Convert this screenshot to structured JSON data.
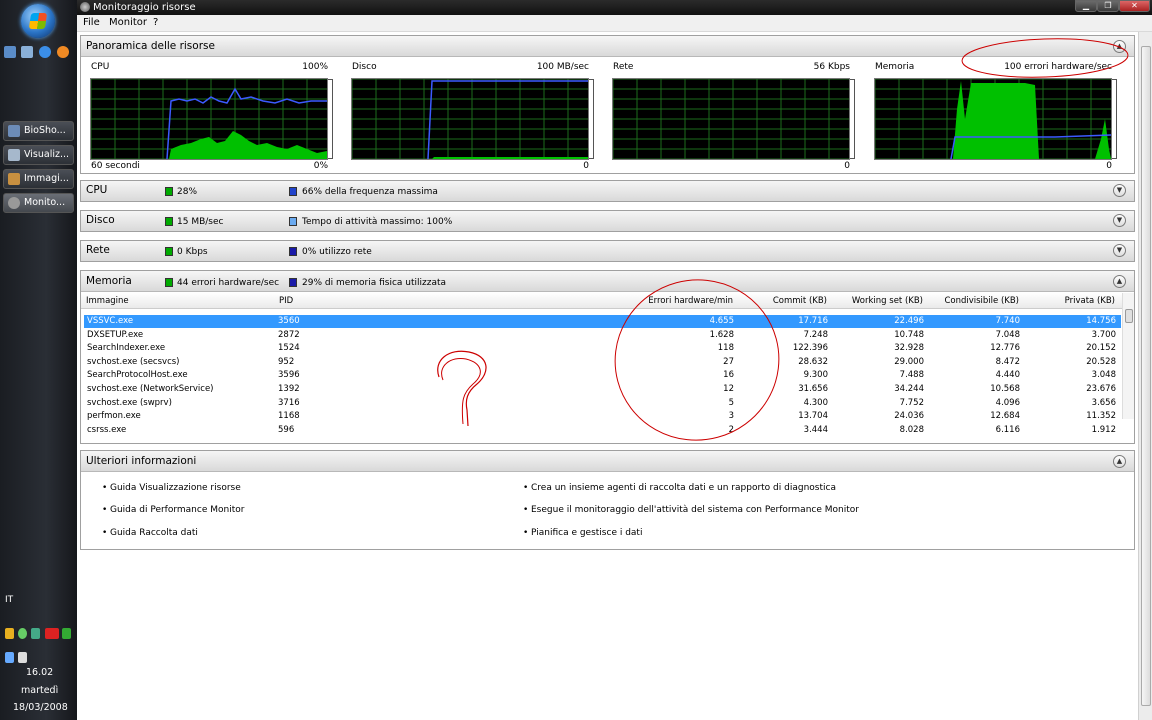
{
  "taskbar": {
    "buttons": [
      {
        "label": "BioSho..."
      },
      {
        "label": "Visualiz..."
      },
      {
        "label": "Immagi..."
      },
      {
        "label": "Monito..."
      }
    ],
    "lang": "IT",
    "time": "16.02",
    "day": "martedì",
    "date": "18/03/2008"
  },
  "window": {
    "title": "Monitoraggio risorse",
    "menu": [
      "File",
      "Monitor",
      "?"
    ]
  },
  "overview": {
    "title": "Panoramica delle risorse",
    "graphs": [
      {
        "name": "CPU",
        "max": "100%",
        "min": "0%",
        "footer": "60 secondi"
      },
      {
        "name": "Disco",
        "max": "100 MB/sec",
        "min": "0",
        "footer": ""
      },
      {
        "name": "Rete",
        "max": "56 Kbps",
        "min": "0",
        "footer": ""
      },
      {
        "name": "Memoria",
        "max": "100 errori hardware/sec",
        "min": "0",
        "footer": ""
      }
    ]
  },
  "sections": [
    {
      "title": "CPU",
      "stat1": "28%",
      "stat2": "66% della frequenza massima"
    },
    {
      "title": "Disco",
      "stat1": "15 MB/sec",
      "stat2": "Tempo di attività massimo: 100%"
    },
    {
      "title": "Rete",
      "stat1": "0 Kbps",
      "stat2": "0% utilizzo rete"
    },
    {
      "title": "Memoria",
      "stat1": "44 errori hardware/sec",
      "stat2": "29% di memoria fisica utilizzata"
    }
  ],
  "memory_table": {
    "columns": [
      "Immagine",
      "PID",
      "Errori hardware/min",
      "Commit (KB)",
      "Working set (KB)",
      "Condivisibile (KB)",
      "Privata (KB)"
    ],
    "rows": [
      [
        "VSSVC.exe",
        "3560",
        "4.655",
        "17.716",
        "22.496",
        "7.740",
        "14.756"
      ],
      [
        "DXSETUP.exe",
        "2872",
        "1.628",
        "7.248",
        "10.748",
        "7.048",
        "3.700"
      ],
      [
        "SearchIndexer.exe",
        "1524",
        "118",
        "122.396",
        "32.928",
        "12.776",
        "20.152"
      ],
      [
        "svchost.exe (secsvcs)",
        "952",
        "27",
        "28.632",
        "29.000",
        "8.472",
        "20.528"
      ],
      [
        "SearchProtocolHost.exe",
        "3596",
        "16",
        "9.300",
        "7.488",
        "4.440",
        "3.048"
      ],
      [
        "svchost.exe (NetworkService)",
        "1392",
        "12",
        "31.656",
        "34.244",
        "10.568",
        "23.676"
      ],
      [
        "svchost.exe (swprv)",
        "3716",
        "5",
        "4.300",
        "7.752",
        "4.096",
        "3.656"
      ],
      [
        "perfmon.exe",
        "1168",
        "3",
        "13.704",
        "24.036",
        "12.684",
        "11.352"
      ],
      [
        "csrss.exe",
        "596",
        "2",
        "3.444",
        "8.028",
        "6.116",
        "1.912"
      ]
    ]
  },
  "more_info": {
    "title": "Ulteriori informazioni",
    "left_links": [
      "Guida Visualizzazione risorse",
      "Guida di Performance Monitor",
      "Guida Raccolta dati"
    ],
    "right_links": [
      "Crea un insieme agenti di raccolta dati e un rapporto di diagnostica",
      "Esegue il monitoraggio dell'attività del sistema con Performance Monitor",
      "Pianifica e gestisce i dati"
    ]
  },
  "colors": {
    "graph_green": "#00c000",
    "graph_blue": "#3c5aff",
    "selection": "#3399ff",
    "annotation": "#cc0000"
  }
}
